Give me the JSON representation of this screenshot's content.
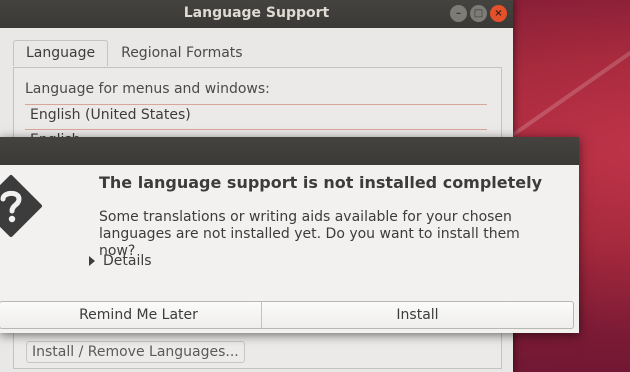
{
  "window": {
    "title": "Language Support",
    "controls": [
      "minimize",
      "maximize",
      "close"
    ]
  },
  "tabs": [
    {
      "label": "Language",
      "active": true
    },
    {
      "label": "Regional Formats",
      "active": false
    }
  ],
  "language_panel": {
    "label": "Language for menus and windows:",
    "languages": [
      "English (United States)",
      "English"
    ],
    "install_remove_label": "Install / Remove Languages..."
  },
  "dialog": {
    "icon": "question-icon",
    "heading": "The language support is not installed completely",
    "body_line1": "Some translations or writing aids available for your chosen",
    "body_line2": "languages are not installed yet. Do you want to install them now?",
    "details_label": "Details",
    "remind_label": "Remind Me Later",
    "install_label": "Install"
  },
  "colors": {
    "titlebar": "#3c3b37",
    "close_button": "#e4502a",
    "dialog_bg": "#f2f1f0",
    "desktop": "#a82a3d"
  }
}
